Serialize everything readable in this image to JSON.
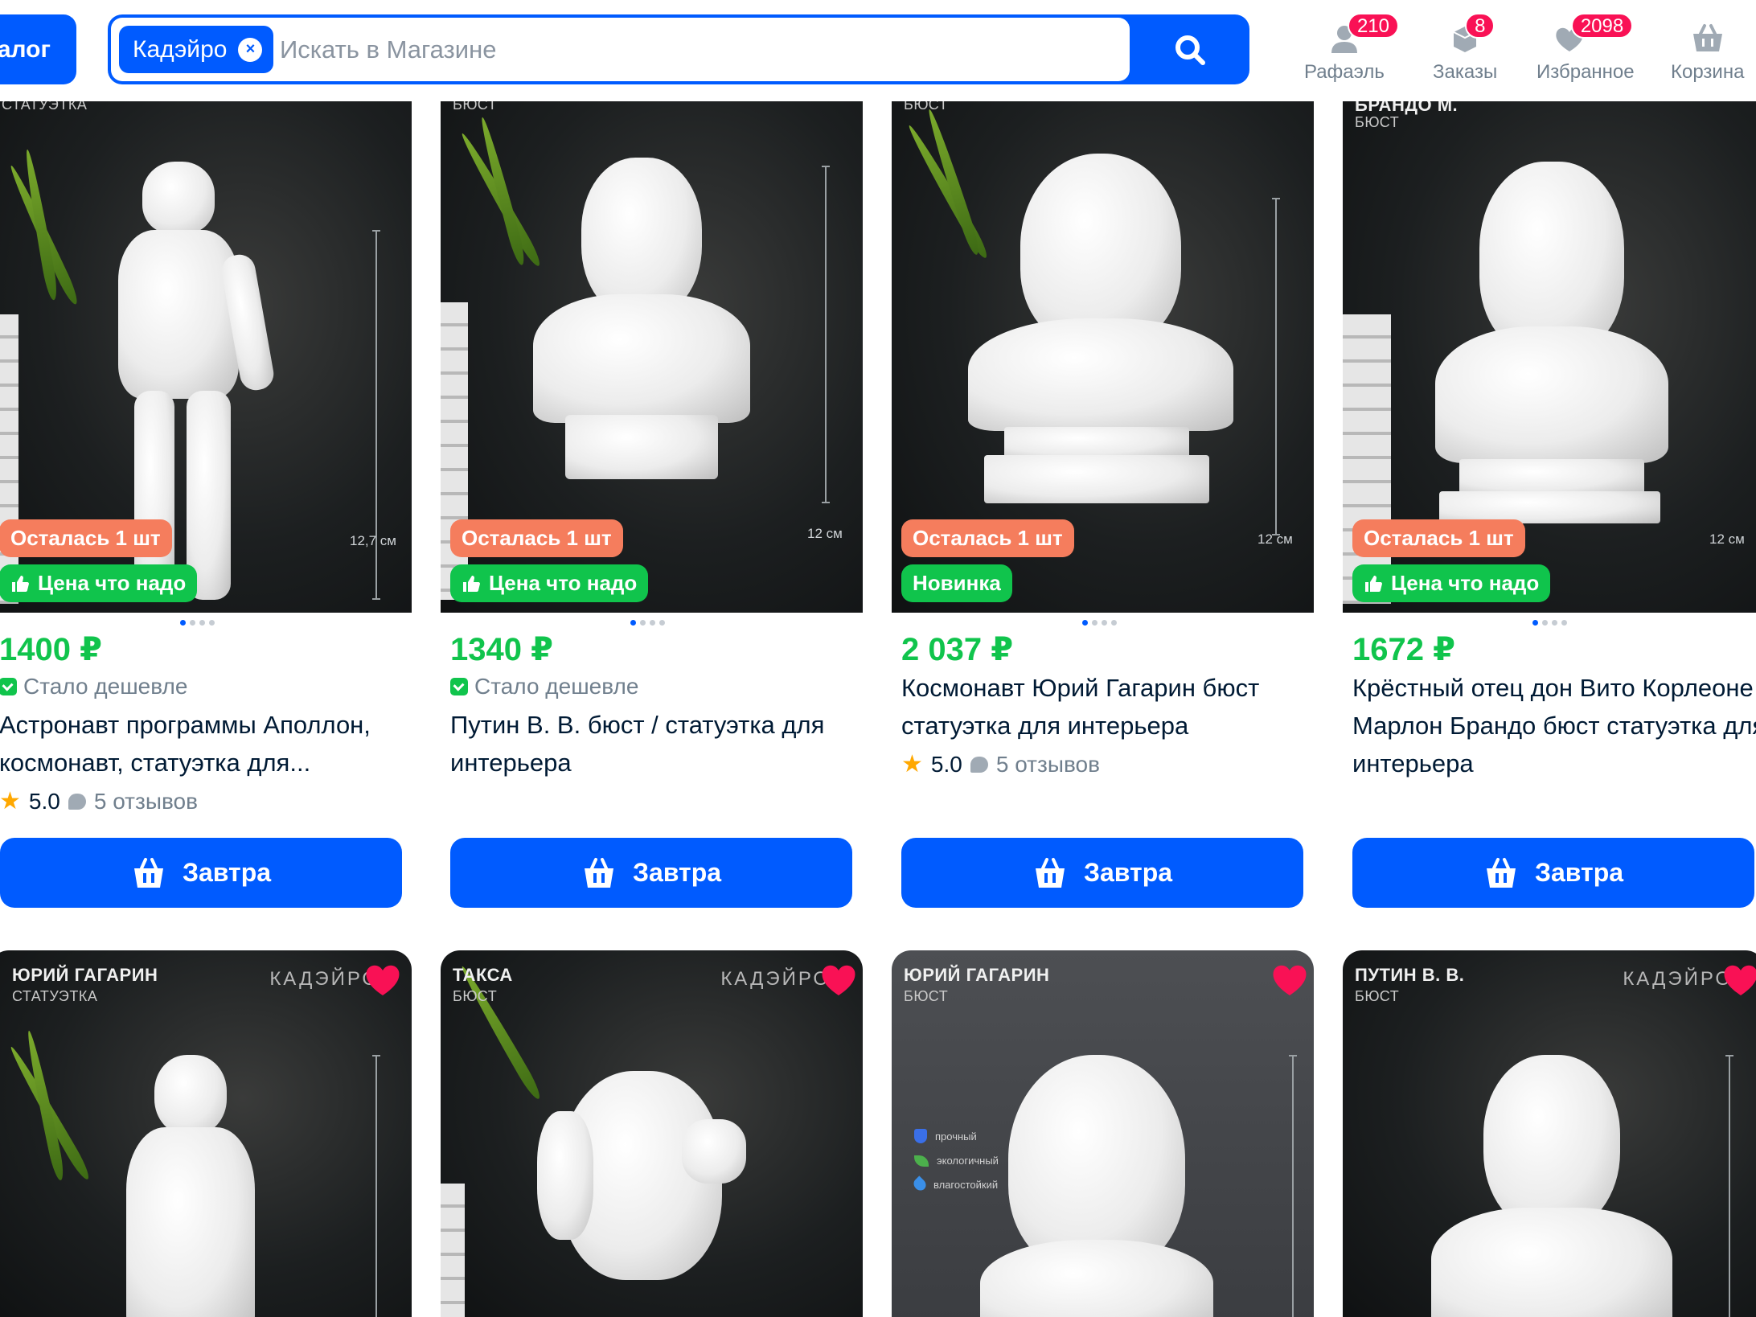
{
  "header": {
    "catalog_label": "алог",
    "search": {
      "chip_label": "Кадэйро",
      "placeholder": "Искать в Магазине"
    },
    "nav": [
      {
        "label": "Рафаэль",
        "badge": "210",
        "icon": "user-icon"
      },
      {
        "label": "Заказы",
        "badge": "8",
        "icon": "box-icon"
      },
      {
        "label": "Избранное",
        "badge": "2098",
        "icon": "heart-icon"
      },
      {
        "label": "Корзина",
        "badge": "",
        "icon": "cart-icon"
      }
    ]
  },
  "products": [
    {
      "photo_title": "",
      "photo_sub": "СТАТУЭТКА",
      "size": "12,7 см",
      "badges": [
        "Осталась 1 шт",
        "Цена что надо"
      ],
      "price": "1400 ₽",
      "cheaper": "Стало дешевле",
      "name": "Астронавт программы Аполлон, космонавт, статуэтка для...",
      "rating": "5.0",
      "reviews": "5 отзывов",
      "button": "Завтра"
    },
    {
      "photo_title": "",
      "photo_sub": "БЮСТ",
      "size": "12 см",
      "badges": [
        "Осталась 1 шт",
        "Цена что надо"
      ],
      "price": "1340 ₽",
      "cheaper": "Стало дешевле",
      "name": "Путин В. В. бюст / статуэтка для интерьера",
      "rating": "",
      "reviews": "",
      "button": "Завтра"
    },
    {
      "photo_title": "",
      "photo_sub": "БЮСТ",
      "size": "12 см",
      "badges": [
        "Осталась 1 шт",
        "Новинка"
      ],
      "price": "2 037 ₽",
      "cheaper": "",
      "name": "Космонавт Юрий Гагарин бюст статуэтка для интерьера",
      "rating": "5.0",
      "reviews": "5 отзывов",
      "button": "Завтра"
    },
    {
      "photo_title": "БРАНДО М.",
      "photo_sub": "БЮСТ",
      "size": "12 см",
      "badges": [
        "Осталась 1 шт",
        "Цена что надо"
      ],
      "price": "1672 ₽",
      "cheaper": "",
      "name": "Крёстный отец дон Вито Корлеоне Марлон Брандо бюст статуэтка для интерьера",
      "rating": "",
      "reviews": "",
      "button": "Завтра"
    }
  ],
  "row2": [
    {
      "title": "ЮРИЙ ГАГАРИН",
      "sub": "СТАТУЭТКА",
      "brand": "КАДЭЙРО"
    },
    {
      "title": "ТАКСА",
      "sub": "БЮСТ",
      "brand": "КАДЭЙРО"
    },
    {
      "title": "ЮРИЙ ГАГАРИН",
      "sub": "БЮСТ",
      "brand": "",
      "features": [
        "прочный",
        "экологичный",
        "влагостойкий"
      ]
    },
    {
      "title": "ПУТИН В. В.",
      "sub": "БЮСТ",
      "brand": "КАДЭЙРО"
    }
  ],
  "colors": {
    "accent": "#005bff",
    "price": "#10c44c",
    "badge_orange": "#f57d5d",
    "badge_green": "#10c44c",
    "heart": "#f91155"
  }
}
